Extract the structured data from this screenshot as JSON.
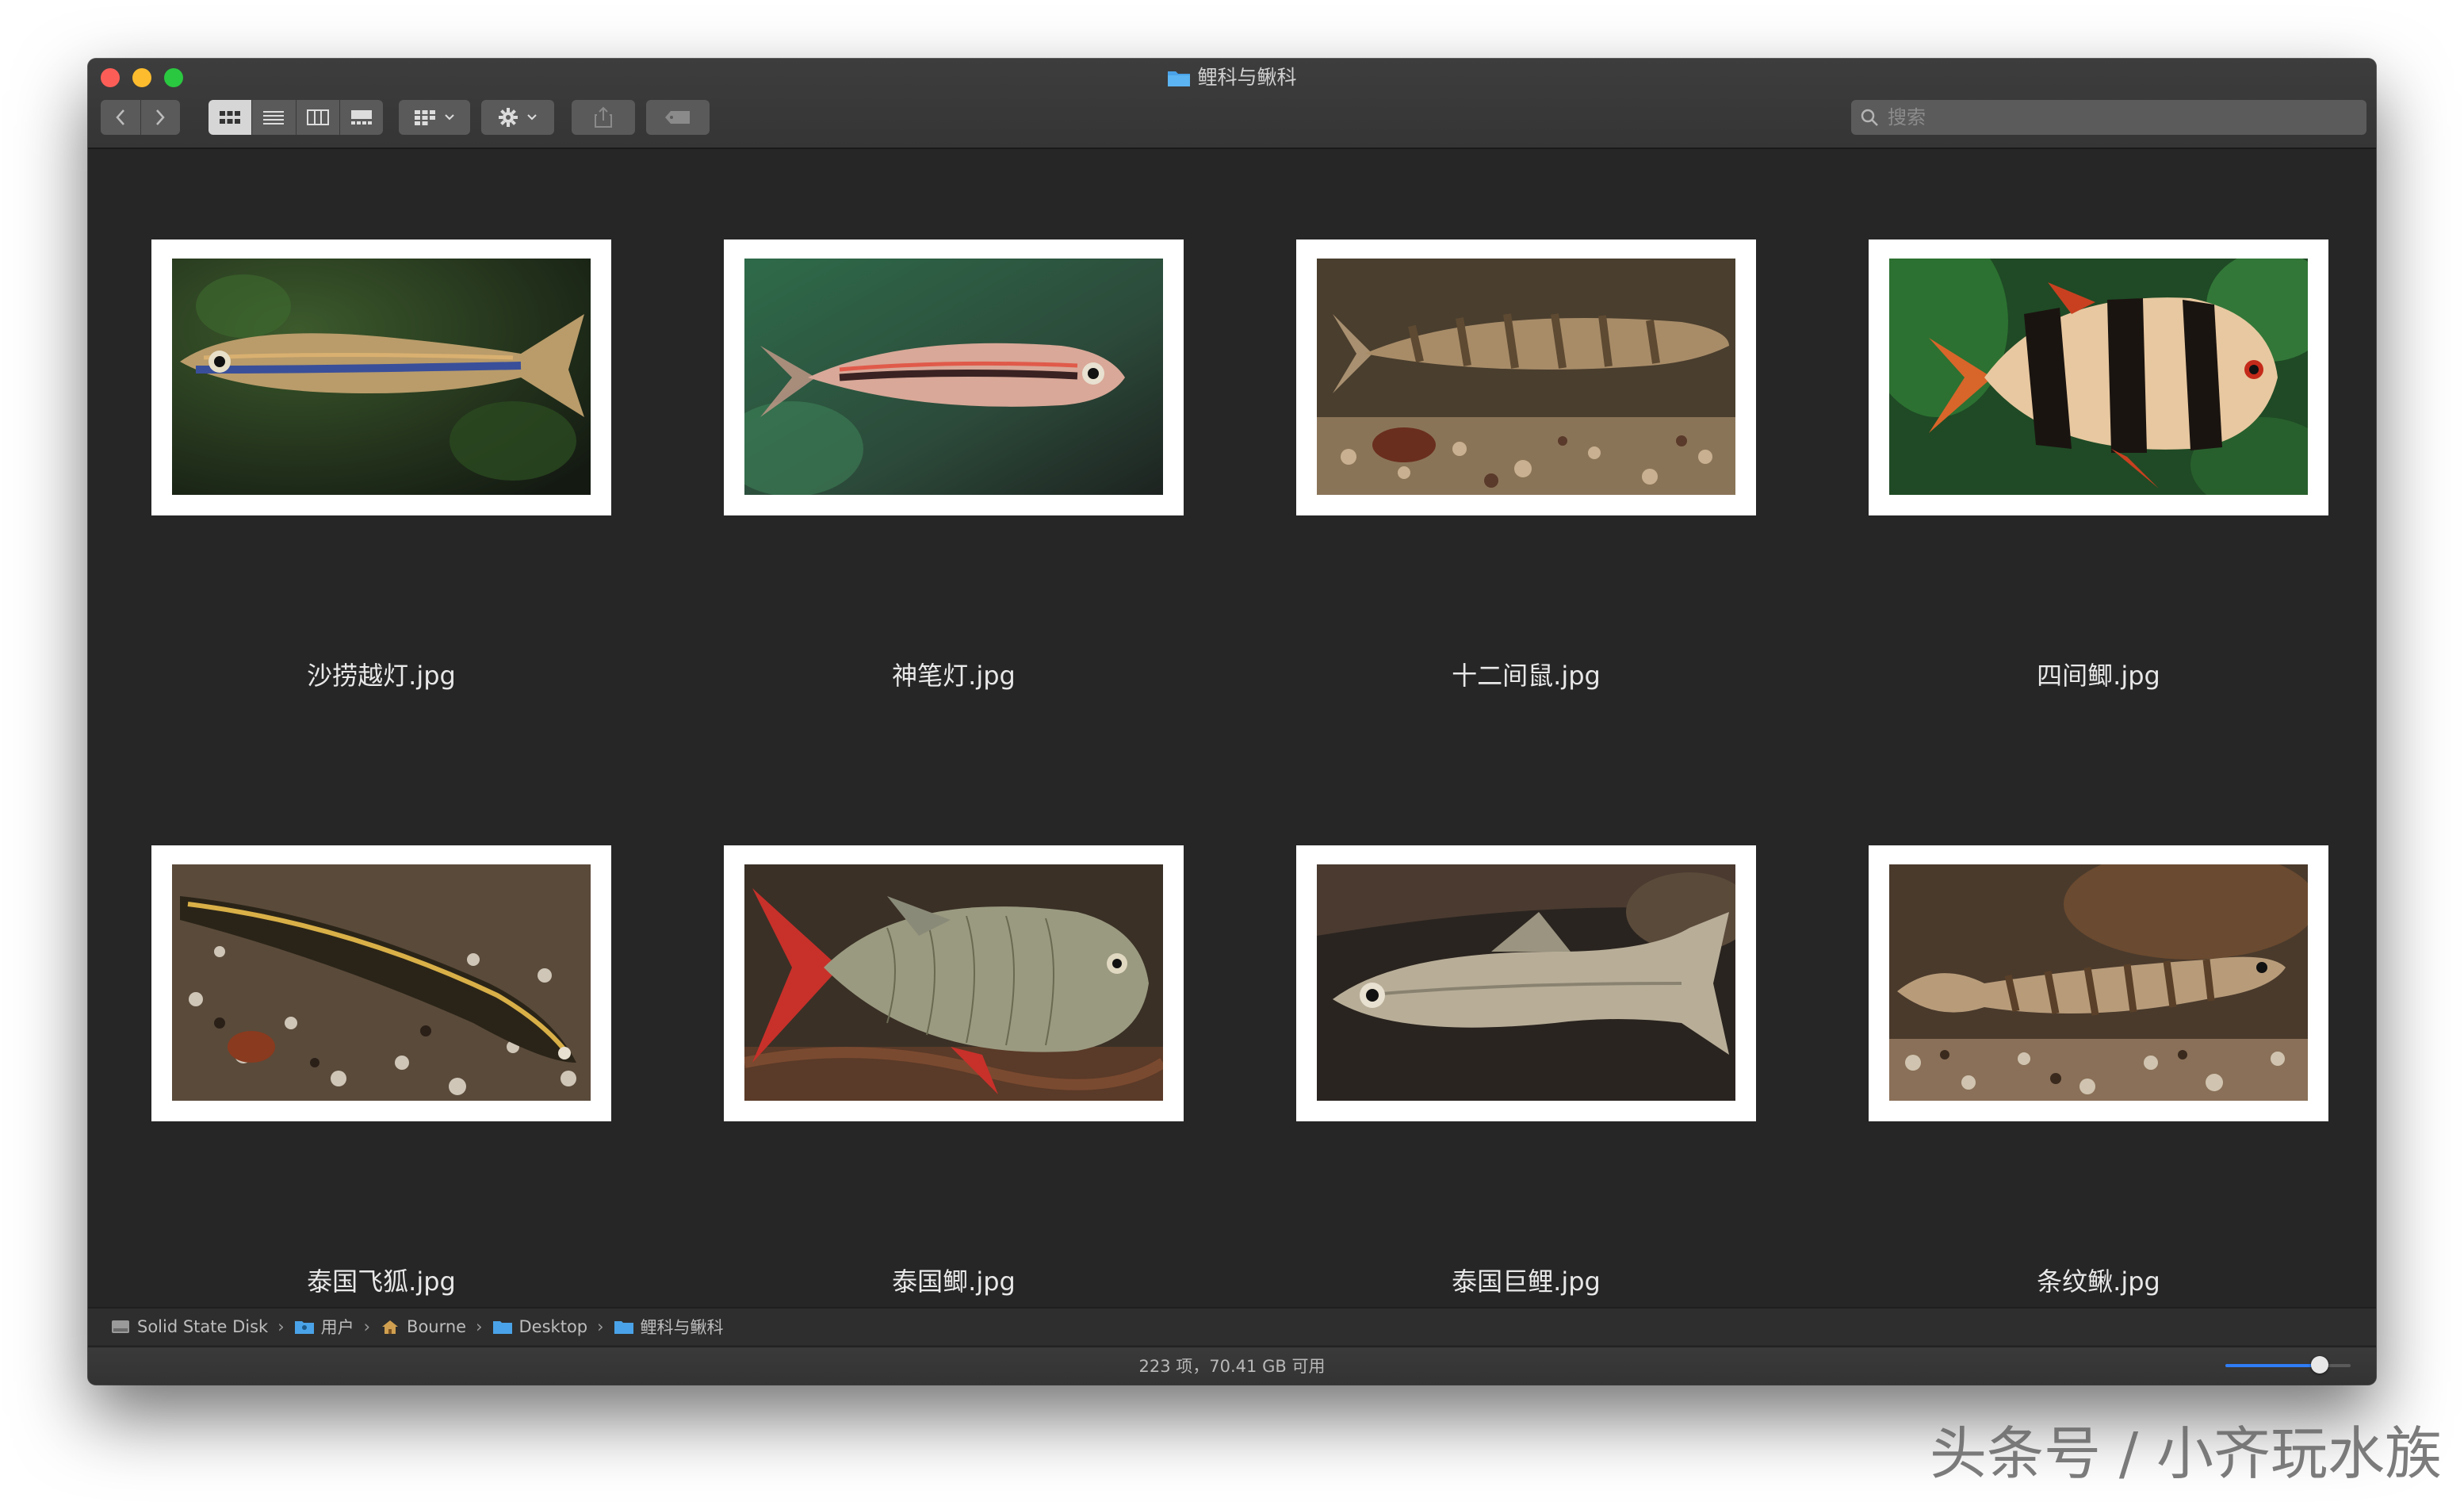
{
  "window": {
    "title": "鲤科与鳅科",
    "search_placeholder": "搜索"
  },
  "toolbar": {
    "back_icon": "chevron-left-icon",
    "forward_icon": "chevron-right-icon",
    "view_modes": [
      "icon-view-icon",
      "list-view-icon",
      "column-view-icon",
      "gallery-view-icon"
    ],
    "active_view": "icon-view",
    "group_icon": "group-by-icon",
    "action_icon": "gear-icon",
    "share_icon": "share-icon",
    "tag_icon": "tag-icon"
  },
  "files": [
    {
      "name": "沙捞越灯.jpg"
    },
    {
      "name": "神笔灯.jpg"
    },
    {
      "name": "十二间鼠.jpg"
    },
    {
      "name": "四间鲫.jpg"
    },
    {
      "name": "泰国飞狐.jpg"
    },
    {
      "name": "泰国鲫.jpg"
    },
    {
      "name": "泰国巨鲤.jpg"
    },
    {
      "name": "条纹鳅.jpg"
    }
  ],
  "pathbar": {
    "items": [
      "Solid State Disk",
      "用户",
      "Bourne",
      "Desktop",
      "鲤科与鳅科"
    ]
  },
  "status": {
    "text": "223 项，70.41 GB 可用"
  },
  "zoom_slider": {
    "level": 0.75
  },
  "colors": {
    "window_bg": "#262626",
    "accent": "#2f7df6",
    "folder": "#4aa3e8"
  },
  "watermark": "头条号 / 小齐玩水族"
}
